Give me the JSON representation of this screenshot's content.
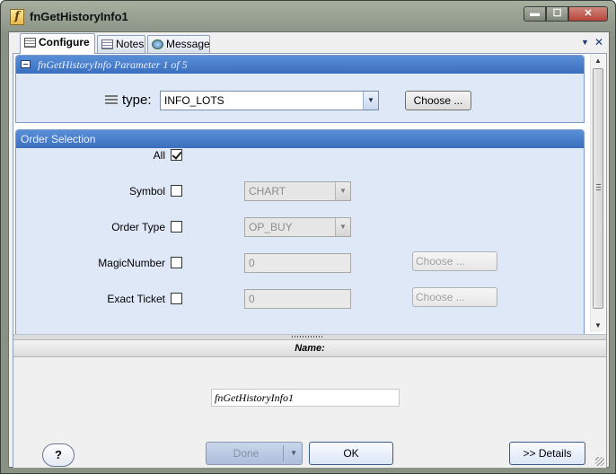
{
  "window": {
    "title": "fnGetHistoryInfo1",
    "icon": "f-function-icon",
    "controls": {
      "minimize": "▬",
      "maximize": "☐",
      "close": "✕"
    }
  },
  "tabs": [
    {
      "label": "Configure",
      "icon": "configure-icon",
      "active": true
    },
    {
      "label": "Notes",
      "icon": "notes-icon",
      "active": false
    },
    {
      "label": "Message",
      "icon": "message-icon",
      "active": false
    }
  ],
  "tab_tools": {
    "dropdown": "▼",
    "close": "✕"
  },
  "parameter_group": {
    "header": "fnGetHistoryInfo Parameter 1 of 5",
    "type_label": "type:",
    "type_value": "INFO_LOTS",
    "choose_label": "Choose ..."
  },
  "order_selection": {
    "header": "Order Selection",
    "all": {
      "label": "All",
      "checked": true
    },
    "symbol": {
      "label": "Symbol",
      "checked": false,
      "value": "CHART"
    },
    "order_type": {
      "label": "Order Type",
      "checked": false,
      "value": "OP_BUY"
    },
    "magic_number": {
      "label": "MagicNumber",
      "checked": false,
      "value": "0",
      "choose_label": "Choose ..."
    },
    "exact_ticket": {
      "label": "Exact Ticket",
      "checked": false,
      "value": "0",
      "choose_label": "Choose ..."
    }
  },
  "name_section": {
    "header": "Name:",
    "value": "fnGetHistoryInfo1"
  },
  "buttons": {
    "help": "?",
    "done": "Done",
    "ok": "OK",
    "details": ">> Details"
  },
  "colors": {
    "accent": "#3a6fbe",
    "group_bg": "#dfe8f7"
  }
}
